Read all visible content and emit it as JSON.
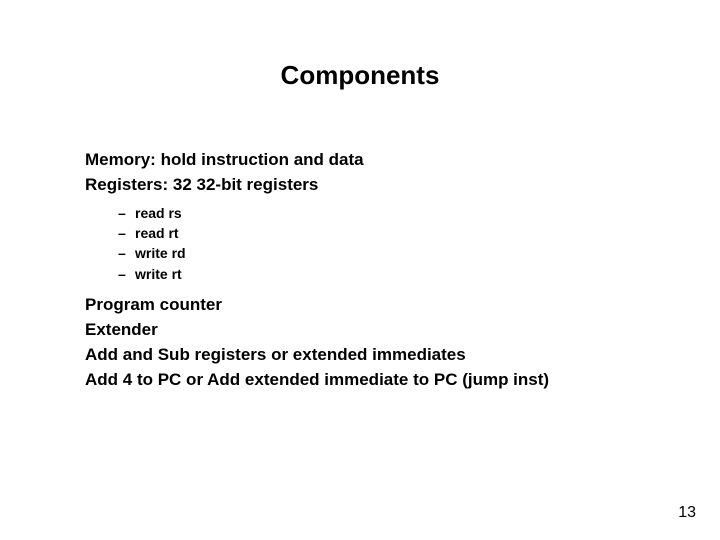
{
  "title": "Components",
  "items": {
    "memory": "Memory: hold instruction and data",
    "registers": "Registers: 32 32-bit registers",
    "subitems": {
      "i0": "read rs",
      "i1": "read rt",
      "i2": "write rd",
      "i3": "write rt"
    },
    "pc": "Program counter",
    "extender": "Extender",
    "addsub": "Add and Sub registers or extended immediates",
    "add4": "Add 4 to PC or Add extended immediate to PC (jump inst)"
  },
  "page_number": "13"
}
